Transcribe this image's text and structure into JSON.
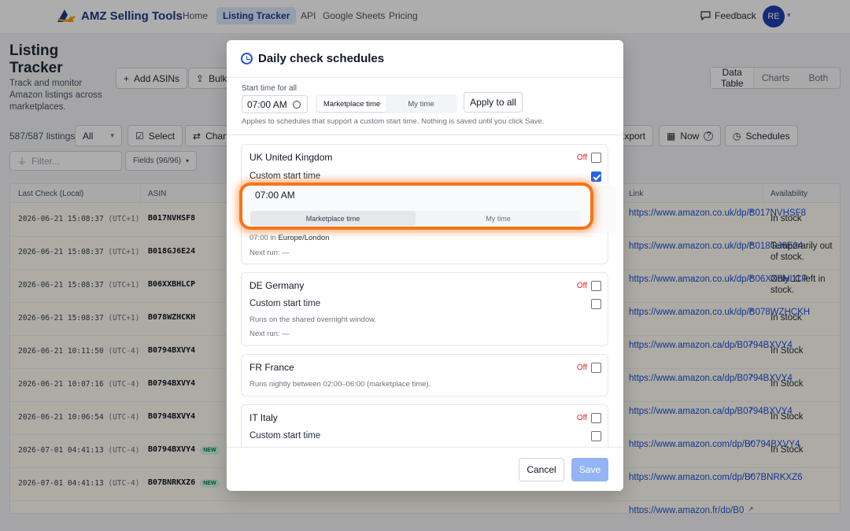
{
  "nav": {
    "brand": "AMZ Selling Tools",
    "links": [
      "Home",
      "Listing Tracker",
      "API",
      "Google Sheets",
      "Pricing"
    ],
    "feedback": "Feedback",
    "avatar": "RE"
  },
  "page": {
    "title": "Listing Tracker",
    "subtitle": "Track and monitor Amazon listings across marketplaces.",
    "add_asins": "Add ASINs",
    "bulk": "Bulk",
    "views": [
      "Data Table",
      "Charts",
      "Both"
    ],
    "count": "587/587 listings",
    "filter_all": "All",
    "select": "Select",
    "change": "Chan",
    "export": "Export",
    "now": "Now",
    "schedules": "Schedules",
    "filter_placeholder": "Filter...",
    "fields": "Fields (96/96)"
  },
  "table": {
    "headers": [
      "Last Check (Local)",
      "ASIN",
      "Link",
      "Availability"
    ],
    "rows": [
      {
        "date": "2026-06-21 15:08:37",
        "tz": "(UTC+1)",
        "asin": "B017NVHSF8",
        "new": "",
        "link": "https://www.amazon.co.uk/dp/B017NVHSF8",
        "avail": "In stock"
      },
      {
        "date": "2026-06-21 15:08:37",
        "tz": "(UTC+1)",
        "asin": "B018GJ6E24",
        "new": "",
        "link": "https://www.amazon.co.uk/dp/B018GJ6E24",
        "avail": "Temporarily out of stock."
      },
      {
        "date": "2026-06-21 15:08:37",
        "tz": "(UTC+1)",
        "asin": "B06XXBHLCP",
        "new": "",
        "link": "https://www.amazon.co.uk/dp/B06XXBHLCP",
        "avail": "Only 11 left in stock."
      },
      {
        "date": "2026-06-21 15:08:37",
        "tz": "(UTC+1)",
        "asin": "B078WZHCKH",
        "new": "",
        "link": "https://www.amazon.co.uk/dp/B078WZHCKH",
        "avail": "In stock"
      },
      {
        "date": "2026-06-21 10:11:50",
        "tz": "(UTC-4)",
        "asin": "B0794BXVY4",
        "new": "",
        "link": "https://www.amazon.ca/dp/B0794BXVY4",
        "avail": "In Stock"
      },
      {
        "date": "2026-06-21 10:07:16",
        "tz": "(UTC-4)",
        "asin": "B0794BXVY4",
        "new": "",
        "link": "https://www.amazon.ca/dp/B0794BXVY4",
        "avail": "In Stock"
      },
      {
        "date": "2026-06-21 10:06:54",
        "tz": "(UTC-4)",
        "asin": "B0794BXVY4",
        "new": "",
        "link": "https://www.amazon.ca/dp/B0794BXVY4",
        "avail": "In Stock"
      },
      {
        "date": "2026-07-01 04:41:13",
        "tz": "(UTC-4)",
        "asin": "B0794BXVY4",
        "new": "NEW",
        "link": "https://www.amazon.com/dp/B0794BXVY4",
        "avail": "In Stock"
      },
      {
        "date": "2026-07-01 04:41:13",
        "tz": "(UTC-4)",
        "asin": "B07BNRKXZ6",
        "new": "NEW",
        "link": "https://www.amazon.com/dp/B07BNRKXZ6",
        "avail": ""
      },
      {
        "date": "",
        "tz": "",
        "asin": "",
        "new": "",
        "link": "https://www.amazon.fr/dp/B0",
        "avail": ""
      }
    ]
  },
  "modal": {
    "title": "Daily check schedules",
    "start_label": "Start time for all",
    "start_time": "07:00 AM",
    "tz_options": [
      "Marketplace time",
      "My time"
    ],
    "apply": "Apply to all",
    "helper": "Applies to schedules that support a custom start time. Nothing is saved until you click Save.",
    "cards": [
      {
        "name": "UK United Kingdom",
        "status": "Off",
        "custom_label": "Custom start time",
        "custom_checked": true,
        "time": "07:00 AM",
        "tz_options": [
          "Marketplace time",
          "My time"
        ],
        "local_prefix": "07:00 in",
        "local_zone": "Europe/London",
        "next_run": "Next run: —"
      },
      {
        "name": "DE Germany",
        "status": "Off",
        "custom_label": "Custom start time",
        "custom_checked": false,
        "note": "Runs on the shared overnight window.",
        "next_run": "Next run: —"
      },
      {
        "name": "FR France",
        "status": "Off",
        "note": "Runs nightly between 02:00–06:00 (marketplace time)."
      },
      {
        "name": "IT Italy",
        "status": "Off",
        "custom_label": "Custom start time",
        "custom_checked": false
      }
    ],
    "cancel": "Cancel",
    "save": "Save"
  },
  "colors": {
    "accent": "#2563eb",
    "highlight": "#f97316",
    "off": "#dc2626"
  }
}
